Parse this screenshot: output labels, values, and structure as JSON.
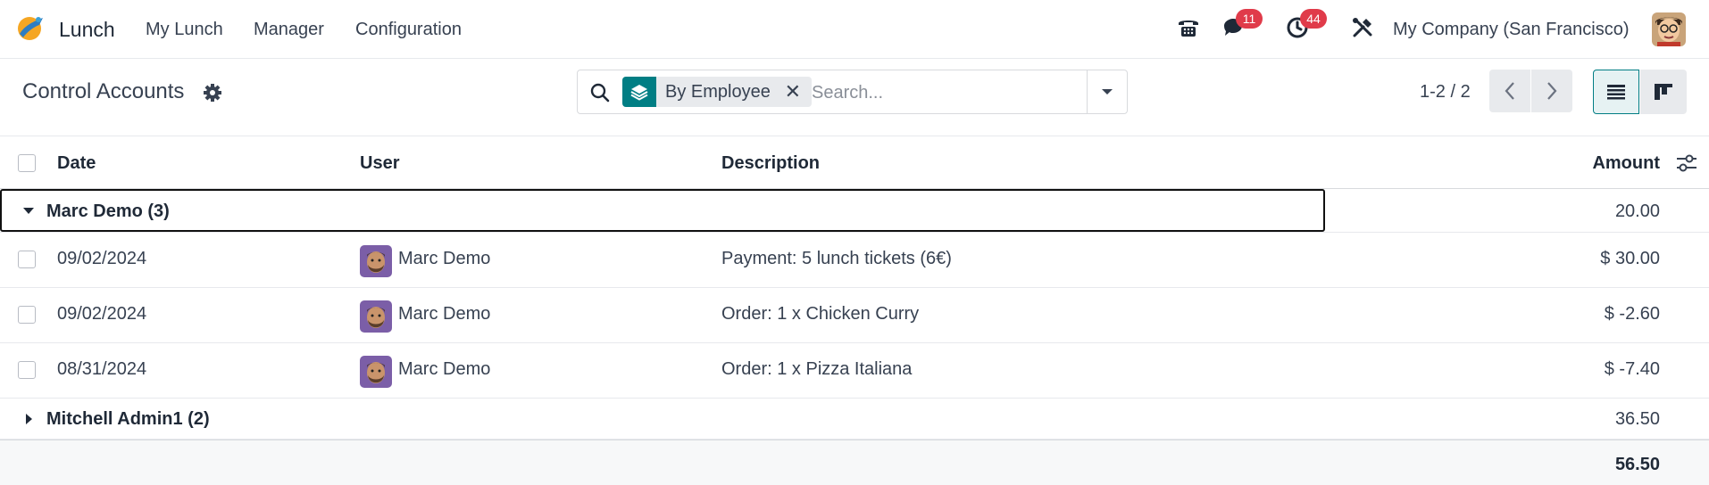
{
  "navbar": {
    "app_name": "Lunch",
    "menus": [
      "My Lunch",
      "Manager",
      "Configuration"
    ],
    "messages_count": "11",
    "activities_count": "44",
    "company": "My Company (San Francisco)",
    "icons": [
      "app-brand-icon",
      "phone-icon",
      "chat-icon",
      "clock-icon",
      "tools-icon",
      "user-avatar"
    ]
  },
  "control_panel": {
    "title": "Control Accounts",
    "search": {
      "facet_label": "By Employee",
      "placeholder": "Search..."
    },
    "pager": "1-2 / 2"
  },
  "list": {
    "columns": {
      "date": "Date",
      "user": "User",
      "description": "Description",
      "amount": "Amount"
    },
    "groups": [
      {
        "label": "Marc Demo (3)",
        "total": "20.00",
        "expanded": true,
        "rows": [
          {
            "date": "09/02/2024",
            "user": "Marc Demo",
            "description": "Payment: 5 lunch tickets (6€)",
            "amount": "$ 30.00"
          },
          {
            "date": "09/02/2024",
            "user": "Marc Demo",
            "description": "Order: 1 x Chicken Curry",
            "amount": "$ -2.60"
          },
          {
            "date": "08/31/2024",
            "user": "Marc Demo",
            "description": "Order: 1 x Pizza Italiana",
            "amount": "$ -7.40"
          }
        ]
      },
      {
        "label": "Mitchell Admin1 (2)",
        "total": "36.50",
        "expanded": false
      }
    ],
    "grand_total": "56.50"
  },
  "colors": {
    "accent": "#017e84",
    "badge": "#e03b4a"
  }
}
